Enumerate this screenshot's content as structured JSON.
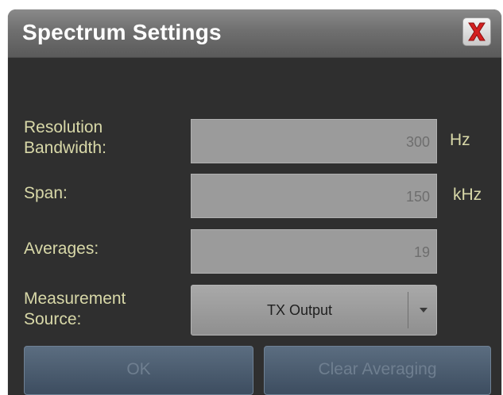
{
  "dialog": {
    "title": "Spectrum Settings",
    "close_icon": "red-x-close-icon"
  },
  "fields": {
    "resolution_bandwidth": {
      "label_line1": "Resolution",
      "label_line2": "Bandwidth:",
      "value": "300",
      "unit": "Hz"
    },
    "span": {
      "label": "Span:",
      "value": "150",
      "unit": "kHz"
    },
    "averages": {
      "label": "Averages:",
      "value": "19"
    },
    "measurement_source": {
      "label_line1": "Measurement",
      "label_line2": "Source:",
      "selected": "TX Output"
    }
  },
  "buttons": {
    "ok": "OK",
    "clear_averaging": "Clear Averaging"
  },
  "colors": {
    "label": "#d8d8a8",
    "background": "#2f2f2f",
    "title_bar": "#6f6f6f",
    "button": "#4a5b6e",
    "close": "#d42020"
  }
}
